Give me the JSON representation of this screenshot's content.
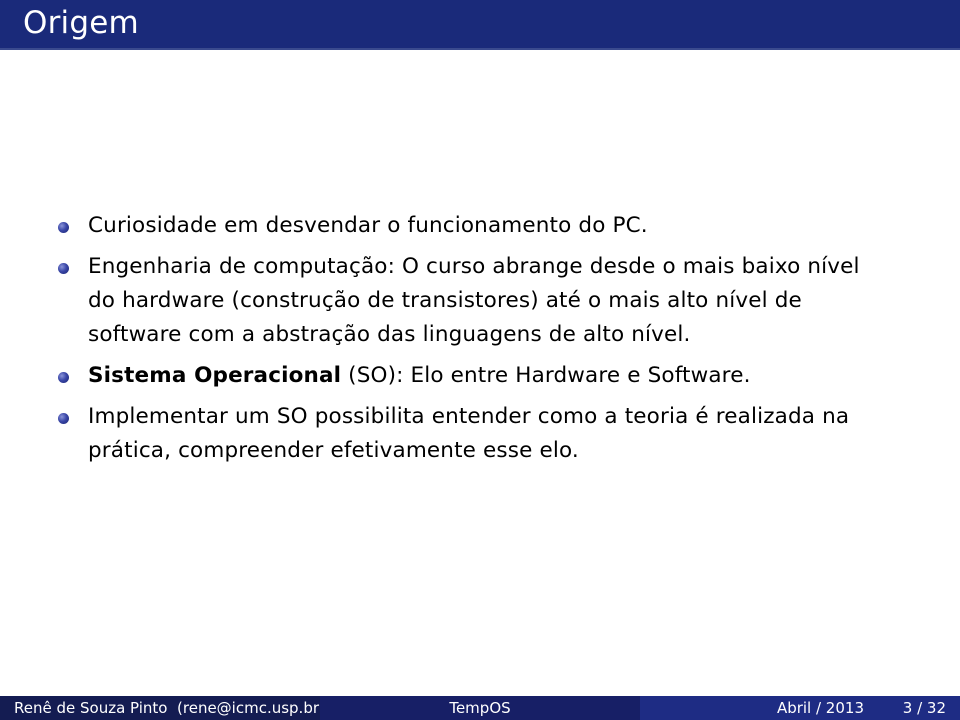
{
  "slide": {
    "title": "Origem",
    "bullets": [
      {
        "text": "Curiosidade em desvendar o funcionamento do PC."
      },
      {
        "lines": [
          "Engenharia de computação: O curso abrange desde o mais baixo nível",
          "do hardware (construção de transistores) até o mais alto nível de",
          "software com a abstração das linguagens de alto nível."
        ]
      },
      {
        "bold": "Sistema Operacional",
        "rest": " (SO): Elo entre Hardware e Software."
      },
      {
        "lines": [
          "Implementar um SO possibilita entender como a teoria é realizada na",
          "prática, compreender efetivamente esse elo."
        ]
      }
    ]
  },
  "footer": {
    "author": "Renê de Souza Pinto  (rene@icmc.usp.br)",
    "project": "TempOS",
    "date": "Abril / 2013",
    "page": "3 / 32"
  },
  "colors": {
    "title_bar": "#1a2a7a",
    "bullet": "#3a47a8",
    "footer_left": "#141c52",
    "footer_mid": "#171f66",
    "footer_right": "#1e2c84"
  }
}
